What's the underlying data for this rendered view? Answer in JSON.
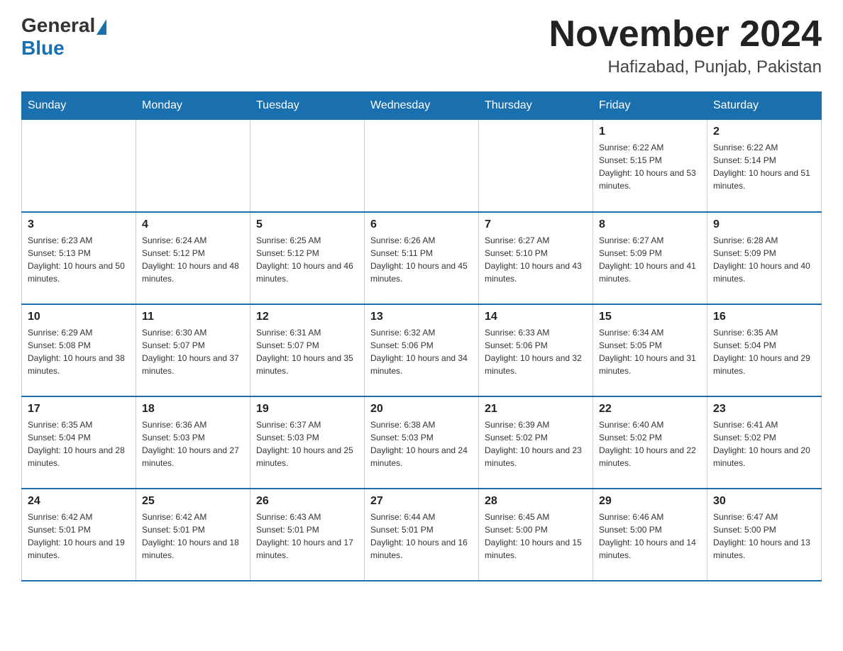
{
  "header": {
    "logo_general": "General",
    "logo_blue": "Blue",
    "month_year": "November 2024",
    "location": "Hafizabad, Punjab, Pakistan"
  },
  "days_of_week": [
    "Sunday",
    "Monday",
    "Tuesday",
    "Wednesday",
    "Thursday",
    "Friday",
    "Saturday"
  ],
  "weeks": [
    [
      {
        "day": "",
        "info": ""
      },
      {
        "day": "",
        "info": ""
      },
      {
        "day": "",
        "info": ""
      },
      {
        "day": "",
        "info": ""
      },
      {
        "day": "",
        "info": ""
      },
      {
        "day": "1",
        "info": "Sunrise: 6:22 AM\nSunset: 5:15 PM\nDaylight: 10 hours and 53 minutes."
      },
      {
        "day": "2",
        "info": "Sunrise: 6:22 AM\nSunset: 5:14 PM\nDaylight: 10 hours and 51 minutes."
      }
    ],
    [
      {
        "day": "3",
        "info": "Sunrise: 6:23 AM\nSunset: 5:13 PM\nDaylight: 10 hours and 50 minutes."
      },
      {
        "day": "4",
        "info": "Sunrise: 6:24 AM\nSunset: 5:12 PM\nDaylight: 10 hours and 48 minutes."
      },
      {
        "day": "5",
        "info": "Sunrise: 6:25 AM\nSunset: 5:12 PM\nDaylight: 10 hours and 46 minutes."
      },
      {
        "day": "6",
        "info": "Sunrise: 6:26 AM\nSunset: 5:11 PM\nDaylight: 10 hours and 45 minutes."
      },
      {
        "day": "7",
        "info": "Sunrise: 6:27 AM\nSunset: 5:10 PM\nDaylight: 10 hours and 43 minutes."
      },
      {
        "day": "8",
        "info": "Sunrise: 6:27 AM\nSunset: 5:09 PM\nDaylight: 10 hours and 41 minutes."
      },
      {
        "day": "9",
        "info": "Sunrise: 6:28 AM\nSunset: 5:09 PM\nDaylight: 10 hours and 40 minutes."
      }
    ],
    [
      {
        "day": "10",
        "info": "Sunrise: 6:29 AM\nSunset: 5:08 PM\nDaylight: 10 hours and 38 minutes."
      },
      {
        "day": "11",
        "info": "Sunrise: 6:30 AM\nSunset: 5:07 PM\nDaylight: 10 hours and 37 minutes."
      },
      {
        "day": "12",
        "info": "Sunrise: 6:31 AM\nSunset: 5:07 PM\nDaylight: 10 hours and 35 minutes."
      },
      {
        "day": "13",
        "info": "Sunrise: 6:32 AM\nSunset: 5:06 PM\nDaylight: 10 hours and 34 minutes."
      },
      {
        "day": "14",
        "info": "Sunrise: 6:33 AM\nSunset: 5:06 PM\nDaylight: 10 hours and 32 minutes."
      },
      {
        "day": "15",
        "info": "Sunrise: 6:34 AM\nSunset: 5:05 PM\nDaylight: 10 hours and 31 minutes."
      },
      {
        "day": "16",
        "info": "Sunrise: 6:35 AM\nSunset: 5:04 PM\nDaylight: 10 hours and 29 minutes."
      }
    ],
    [
      {
        "day": "17",
        "info": "Sunrise: 6:35 AM\nSunset: 5:04 PM\nDaylight: 10 hours and 28 minutes."
      },
      {
        "day": "18",
        "info": "Sunrise: 6:36 AM\nSunset: 5:03 PM\nDaylight: 10 hours and 27 minutes."
      },
      {
        "day": "19",
        "info": "Sunrise: 6:37 AM\nSunset: 5:03 PM\nDaylight: 10 hours and 25 minutes."
      },
      {
        "day": "20",
        "info": "Sunrise: 6:38 AM\nSunset: 5:03 PM\nDaylight: 10 hours and 24 minutes."
      },
      {
        "day": "21",
        "info": "Sunrise: 6:39 AM\nSunset: 5:02 PM\nDaylight: 10 hours and 23 minutes."
      },
      {
        "day": "22",
        "info": "Sunrise: 6:40 AM\nSunset: 5:02 PM\nDaylight: 10 hours and 22 minutes."
      },
      {
        "day": "23",
        "info": "Sunrise: 6:41 AM\nSunset: 5:02 PM\nDaylight: 10 hours and 20 minutes."
      }
    ],
    [
      {
        "day": "24",
        "info": "Sunrise: 6:42 AM\nSunset: 5:01 PM\nDaylight: 10 hours and 19 minutes."
      },
      {
        "day": "25",
        "info": "Sunrise: 6:42 AM\nSunset: 5:01 PM\nDaylight: 10 hours and 18 minutes."
      },
      {
        "day": "26",
        "info": "Sunrise: 6:43 AM\nSunset: 5:01 PM\nDaylight: 10 hours and 17 minutes."
      },
      {
        "day": "27",
        "info": "Sunrise: 6:44 AM\nSunset: 5:01 PM\nDaylight: 10 hours and 16 minutes."
      },
      {
        "day": "28",
        "info": "Sunrise: 6:45 AM\nSunset: 5:00 PM\nDaylight: 10 hours and 15 minutes."
      },
      {
        "day": "29",
        "info": "Sunrise: 6:46 AM\nSunset: 5:00 PM\nDaylight: 10 hours and 14 minutes."
      },
      {
        "day": "30",
        "info": "Sunrise: 6:47 AM\nSunset: 5:00 PM\nDaylight: 10 hours and 13 minutes."
      }
    ]
  ]
}
